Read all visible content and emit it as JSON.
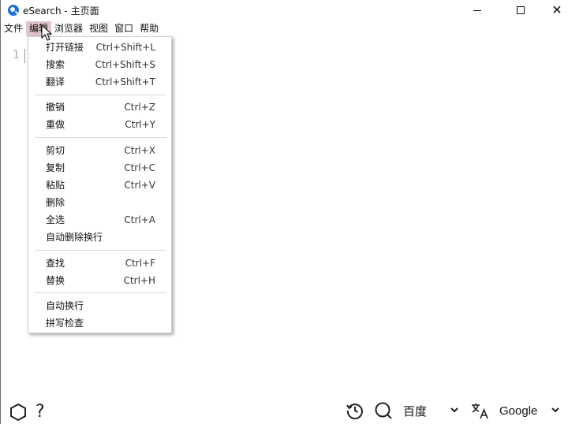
{
  "window": {
    "title": "eSearch - 主页面",
    "icon": "magnifier-app-icon"
  },
  "menubar": [
    {
      "label": "文件",
      "active": false
    },
    {
      "label": "编辑",
      "active": true
    },
    {
      "label": "浏览器",
      "active": false
    },
    {
      "label": "视图",
      "active": false
    },
    {
      "label": "窗口",
      "active": false
    },
    {
      "label": "帮助",
      "active": false
    }
  ],
  "editor": {
    "line_number": "1"
  },
  "edit_menu": {
    "items": [
      {
        "label": "打开链接",
        "shortcut": "Ctrl+Shift+L"
      },
      {
        "label": "搜索",
        "shortcut": "Ctrl+Shift+S"
      },
      {
        "label": "翻译",
        "shortcut": "Ctrl+Shift+T"
      },
      {
        "label": "撤销",
        "shortcut": "Ctrl+Z"
      },
      {
        "label": "重做",
        "shortcut": "Ctrl+Y"
      },
      {
        "label": "剪切",
        "shortcut": "Ctrl+X"
      },
      {
        "label": "复制",
        "shortcut": "Ctrl+C"
      },
      {
        "label": "粘贴",
        "shortcut": "Ctrl+V"
      },
      {
        "label": "删除",
        "shortcut": ""
      },
      {
        "label": "全选",
        "shortcut": "Ctrl+A"
      },
      {
        "label": "自动删除换行",
        "shortcut": ""
      },
      {
        "label": "查找",
        "shortcut": "Ctrl+F"
      },
      {
        "label": "替换",
        "shortcut": "Ctrl+H"
      },
      {
        "label": "自动换行",
        "shortcut": ""
      },
      {
        "label": "拼写检查",
        "shortcut": ""
      }
    ]
  },
  "bottombar": {
    "help_glyph": "?",
    "search_engine": "百度",
    "translate_engine": "Google"
  },
  "colors": {
    "active_menu_bg": "#dfc4c8",
    "app_icon": "#1e6fd9"
  }
}
